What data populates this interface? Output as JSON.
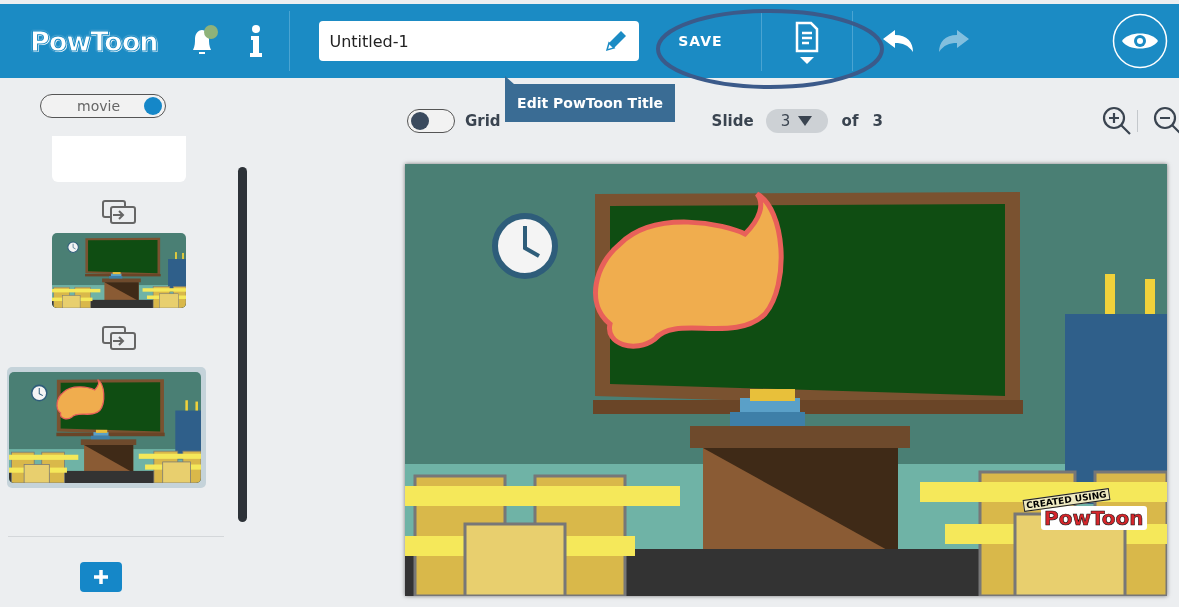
{
  "header": {
    "logo": "PowToon",
    "title_field": {
      "value": "Untitled-1"
    },
    "save_button": "SAVE",
    "undo": {
      "disabled": false
    },
    "redo": {
      "disabled": true
    }
  },
  "tooltip": "Edit PowToon Title",
  "sidebar": {
    "mode_toggle": {
      "label": "movie",
      "on": true
    },
    "slides": [
      {
        "kind": "text",
        "selected": false
      },
      {
        "kind": "classroom",
        "selected": false
      },
      {
        "kind": "classroom_bubble",
        "selected": true
      }
    ]
  },
  "toolbar": {
    "grid": {
      "label": "Grid",
      "on": false
    },
    "slide_label": "Slide",
    "slide_value": "3",
    "of_label": "of",
    "slide_total": "3"
  },
  "canvas": {
    "kind": "classroom_bubble",
    "watermark": {
      "caption": "CREATED USING",
      "logo": "PowToon"
    }
  }
}
